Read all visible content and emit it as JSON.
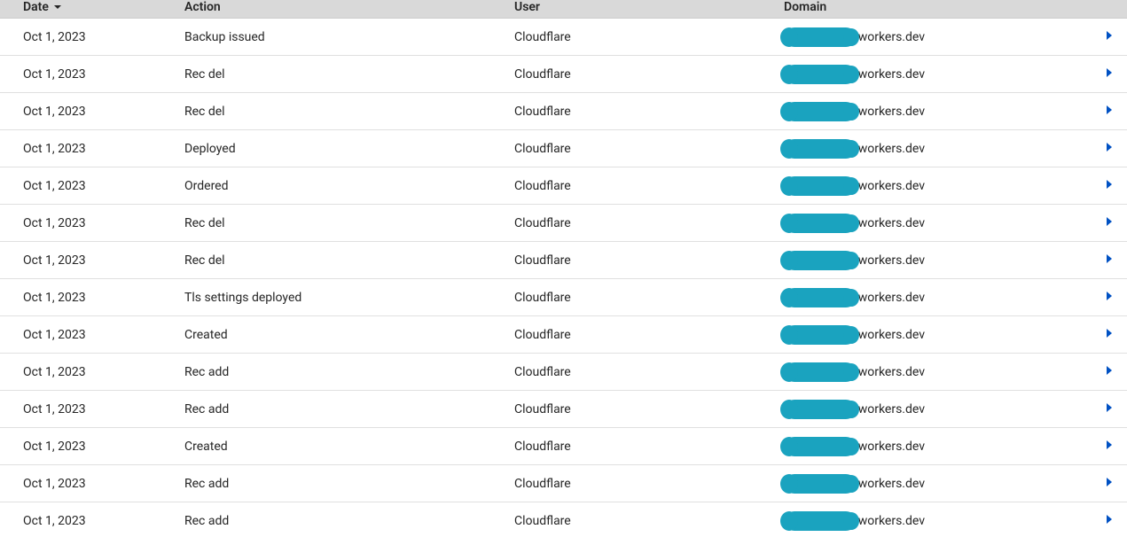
{
  "columns": {
    "date": "Date",
    "action": "Action",
    "user": "User",
    "domain": "Domain"
  },
  "domain_suffix": ".workers.dev",
  "rows": [
    {
      "date": "Oct 1, 2023",
      "action": "Backup issued",
      "user": "Cloudflare"
    },
    {
      "date": "Oct 1, 2023",
      "action": "Rec del",
      "user": "Cloudflare"
    },
    {
      "date": "Oct 1, 2023",
      "action": "Rec del",
      "user": "Cloudflare"
    },
    {
      "date": "Oct 1, 2023",
      "action": "Deployed",
      "user": "Cloudflare"
    },
    {
      "date": "Oct 1, 2023",
      "action": "Ordered",
      "user": "Cloudflare"
    },
    {
      "date": "Oct 1, 2023",
      "action": "Rec del",
      "user": "Cloudflare"
    },
    {
      "date": "Oct 1, 2023",
      "action": "Rec del",
      "user": "Cloudflare"
    },
    {
      "date": "Oct 1, 2023",
      "action": "Tls settings deployed",
      "user": "Cloudflare"
    },
    {
      "date": "Oct 1, 2023",
      "action": "Created",
      "user": "Cloudflare"
    },
    {
      "date": "Oct 1, 2023",
      "action": "Rec add",
      "user": "Cloudflare"
    },
    {
      "date": "Oct 1, 2023",
      "action": "Rec add",
      "user": "Cloudflare"
    },
    {
      "date": "Oct 1, 2023",
      "action": "Created",
      "user": "Cloudflare"
    },
    {
      "date": "Oct 1, 2023",
      "action": "Rec add",
      "user": "Cloudflare"
    },
    {
      "date": "Oct 1, 2023",
      "action": "Rec add",
      "user": "Cloudflare"
    }
  ]
}
